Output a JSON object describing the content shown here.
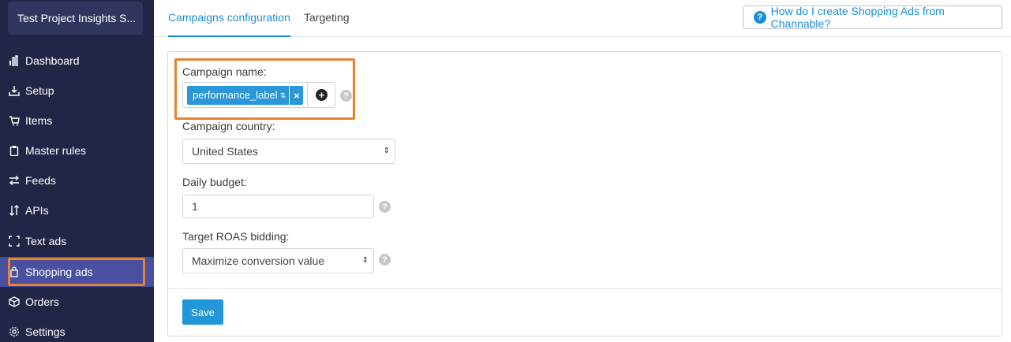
{
  "sidebar": {
    "project_name": "Test Project Insights S...",
    "items": [
      {
        "label": "Dashboard",
        "icon": "bar-chart-icon"
      },
      {
        "label": "Setup",
        "icon": "download-tray-icon"
      },
      {
        "label": "Items",
        "icon": "cart-icon"
      },
      {
        "label": "Master rules",
        "icon": "clipboard-icon"
      },
      {
        "label": "Feeds",
        "icon": "arrows-exchange-icon"
      },
      {
        "label": "APIs",
        "icon": "up-down-arrows-icon"
      },
      {
        "label": "Text ads",
        "icon": "brackets-icon"
      },
      {
        "label": "Shopping ads",
        "icon": "shopping-bag-icon",
        "active": true
      },
      {
        "label": "Orders",
        "icon": "box-icon"
      },
      {
        "label": "Settings",
        "icon": "gear-icon"
      }
    ]
  },
  "tabs": {
    "items": [
      {
        "label": "Campaigns configuration",
        "active": true
      },
      {
        "label": "Targeting",
        "active": false
      }
    ]
  },
  "help": {
    "label": "How do I create Shopping Ads from Channable?"
  },
  "form": {
    "campaign_name": {
      "label": "Campaign name:",
      "tag": "performance_label",
      "remove": "×",
      "add": "+"
    },
    "campaign_country": {
      "label": "Campaign country:",
      "value": "United States"
    },
    "daily_budget": {
      "label": "Daily budget:",
      "value": "1"
    },
    "target_roas": {
      "label": "Target ROAS bidding:",
      "value": "Maximize conversion value"
    },
    "hint_glyph": "?",
    "save_label": "Save"
  },
  "colors": {
    "sidebar_bg": "#222646",
    "active_item": "#4a4fa0",
    "accent": "#1b8fd6",
    "highlight": "#e6812d"
  }
}
